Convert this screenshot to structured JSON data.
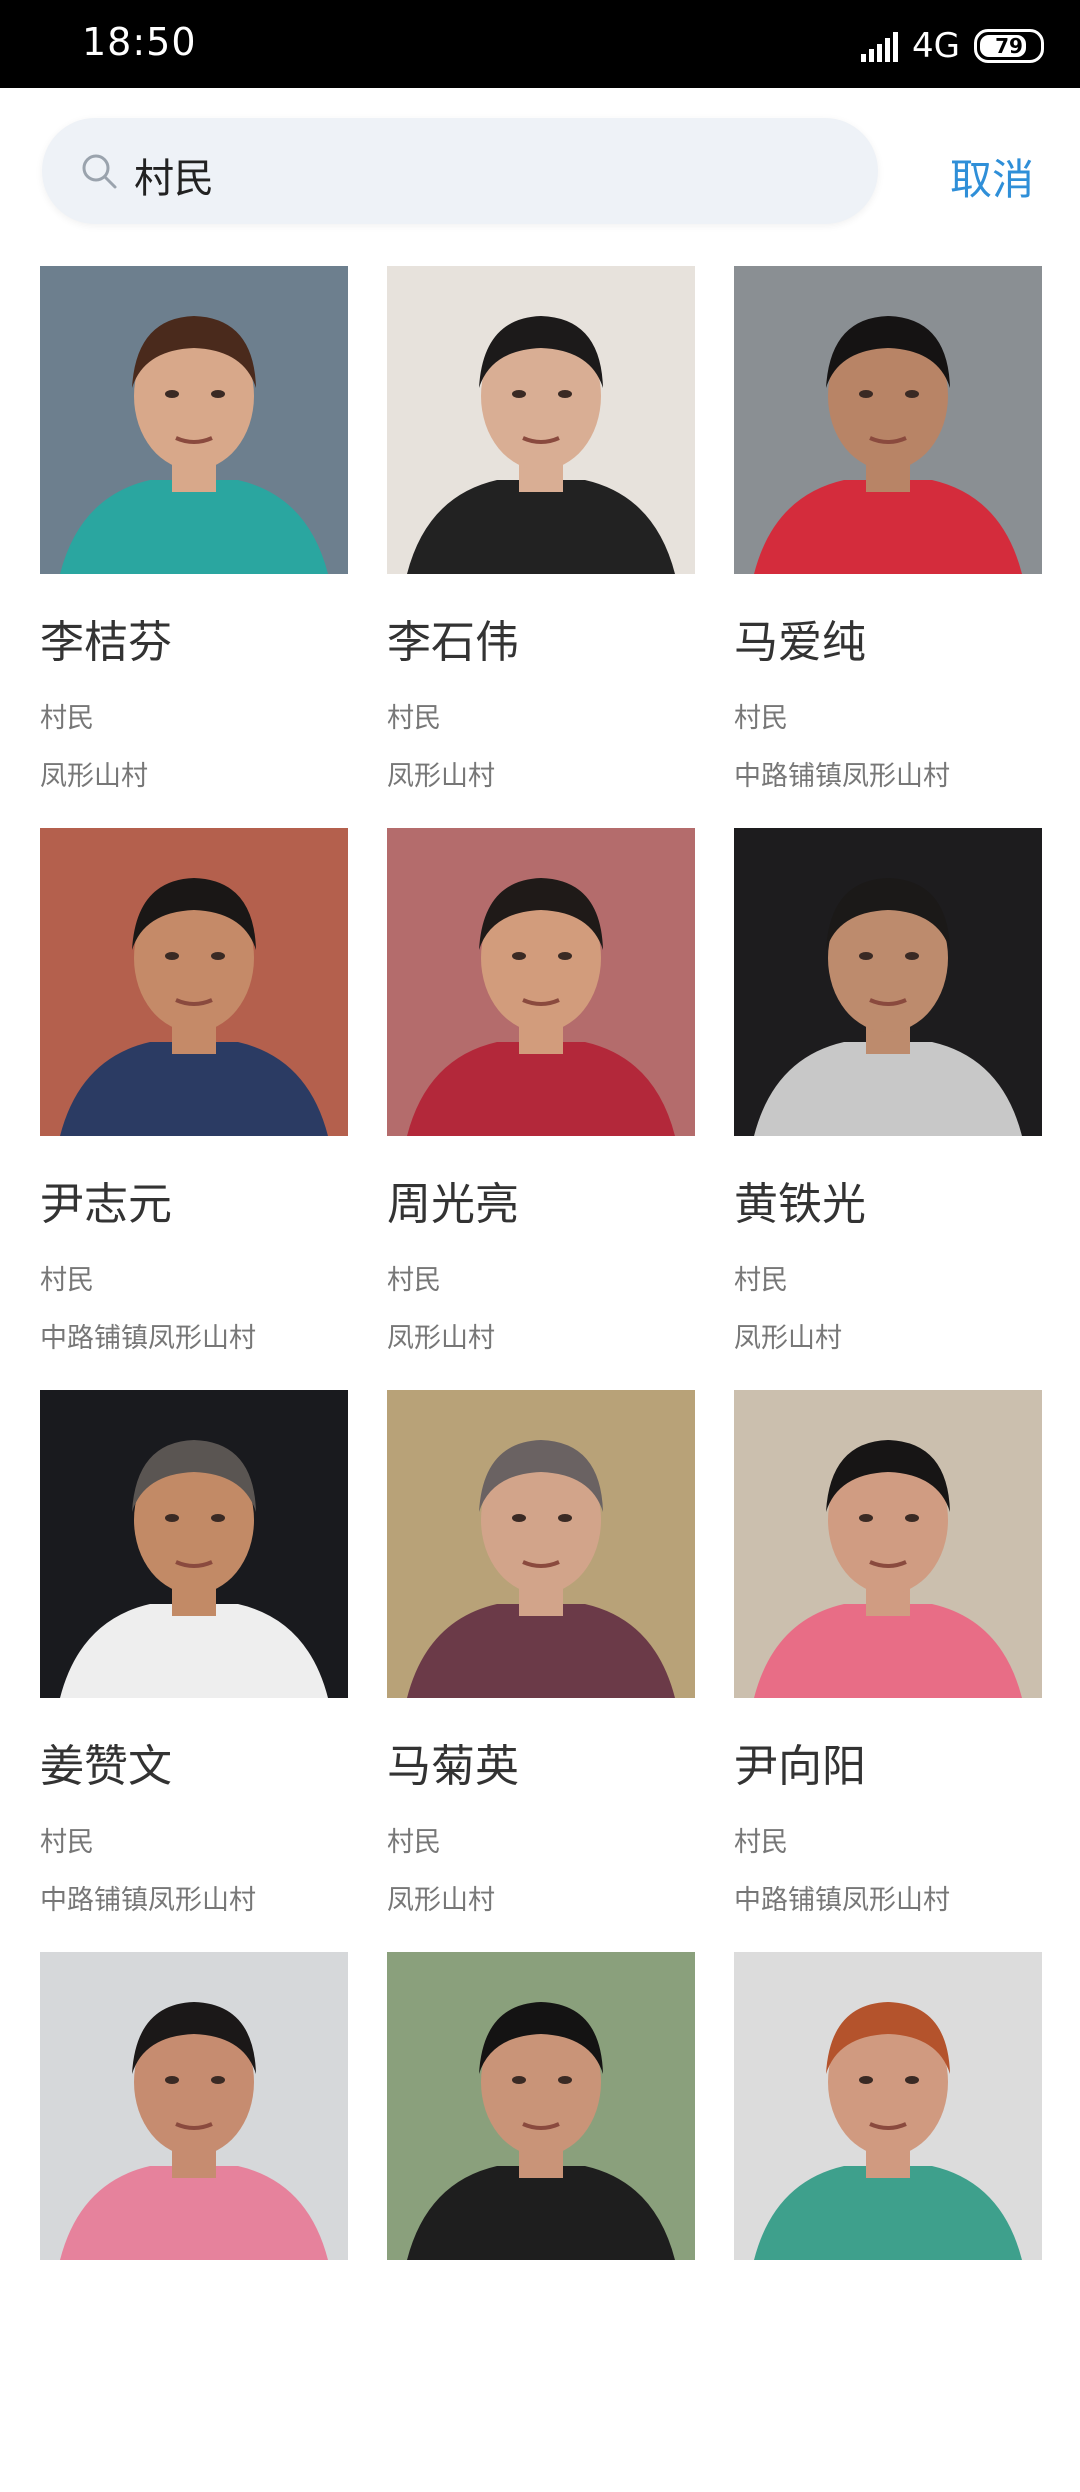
{
  "status_bar": {
    "time": "18:50",
    "network": "4G",
    "battery": "79",
    "battery_level": 0.79
  },
  "search": {
    "query": "村民",
    "cancel_label": "取消"
  },
  "results": [
    {
      "name": "李桔芬",
      "role": "村民",
      "village": "凤形山村",
      "bg": "#6d7f8e",
      "skin": "#d8a88a",
      "hair": "#4a2a1c",
      "shirt": "#2aa6a0"
    },
    {
      "name": "李石伟",
      "role": "村民",
      "village": "凤形山村",
      "bg": "#e7e2dc",
      "skin": "#d9ae94",
      "hair": "#1c1a1a",
      "shirt": "#222222"
    },
    {
      "name": "马爱纯",
      "role": "村民",
      "village": "中路铺镇凤形山村",
      "bg": "#8a8f93",
      "skin": "#b88466",
      "hair": "#151313",
      "shirt": "#d42c3c"
    },
    {
      "name": "尹志元",
      "role": "村民",
      "village": "中路铺镇凤形山村",
      "bg": "#b4604d",
      "skin": "#c58a68",
      "hair": "#1a1716",
      "shirt": "#2b3b63"
    },
    {
      "name": "周光亮",
      "role": "村民",
      "village": "凤形山村",
      "bg": "#b46c6c",
      "skin": "#d29c7c",
      "hair": "#1f1a18",
      "shirt": "#b3283a"
    },
    {
      "name": "黄铁光",
      "role": "村民",
      "village": "凤形山村",
      "bg": "#1d1c1e",
      "skin": "#bd8b6d",
      "hair": "#1b1918",
      "shirt": "#c8c8c8"
    },
    {
      "name": "姜赞文",
      "role": "村民",
      "village": "中路铺镇凤形山村",
      "bg": "#191a1e",
      "skin": "#c28a66",
      "hair": "#5a5552",
      "shirt": "#eeeeee"
    },
    {
      "name": "马菊英",
      "role": "村民",
      "village": "凤形山村",
      "bg": "#b8a278",
      "skin": "#d2a48a",
      "hair": "#6a6262",
      "shirt": "#6b3a48"
    },
    {
      "name": "尹向阳",
      "role": "村民",
      "village": "中路铺镇凤形山村",
      "bg": "#cbbfae",
      "skin": "#d09c82",
      "hair": "#171515",
      "shirt": "#e86d86"
    },
    {
      "name": "",
      "role": "",
      "village": "",
      "bg": "#d6d8da",
      "skin": "#c68c70",
      "hair": "#1b1818",
      "shirt": "#e6829c"
    },
    {
      "name": "",
      "role": "",
      "village": "",
      "bg": "#8aa07c",
      "skin": "#c99478",
      "hair": "#141313",
      "shirt": "#1e1e1e"
    },
    {
      "name": "",
      "role": "",
      "village": "",
      "bg": "#dcdcdc",
      "skin": "#d09a80",
      "hair": "#b4532c",
      "shirt": "#3ea08c"
    }
  ]
}
